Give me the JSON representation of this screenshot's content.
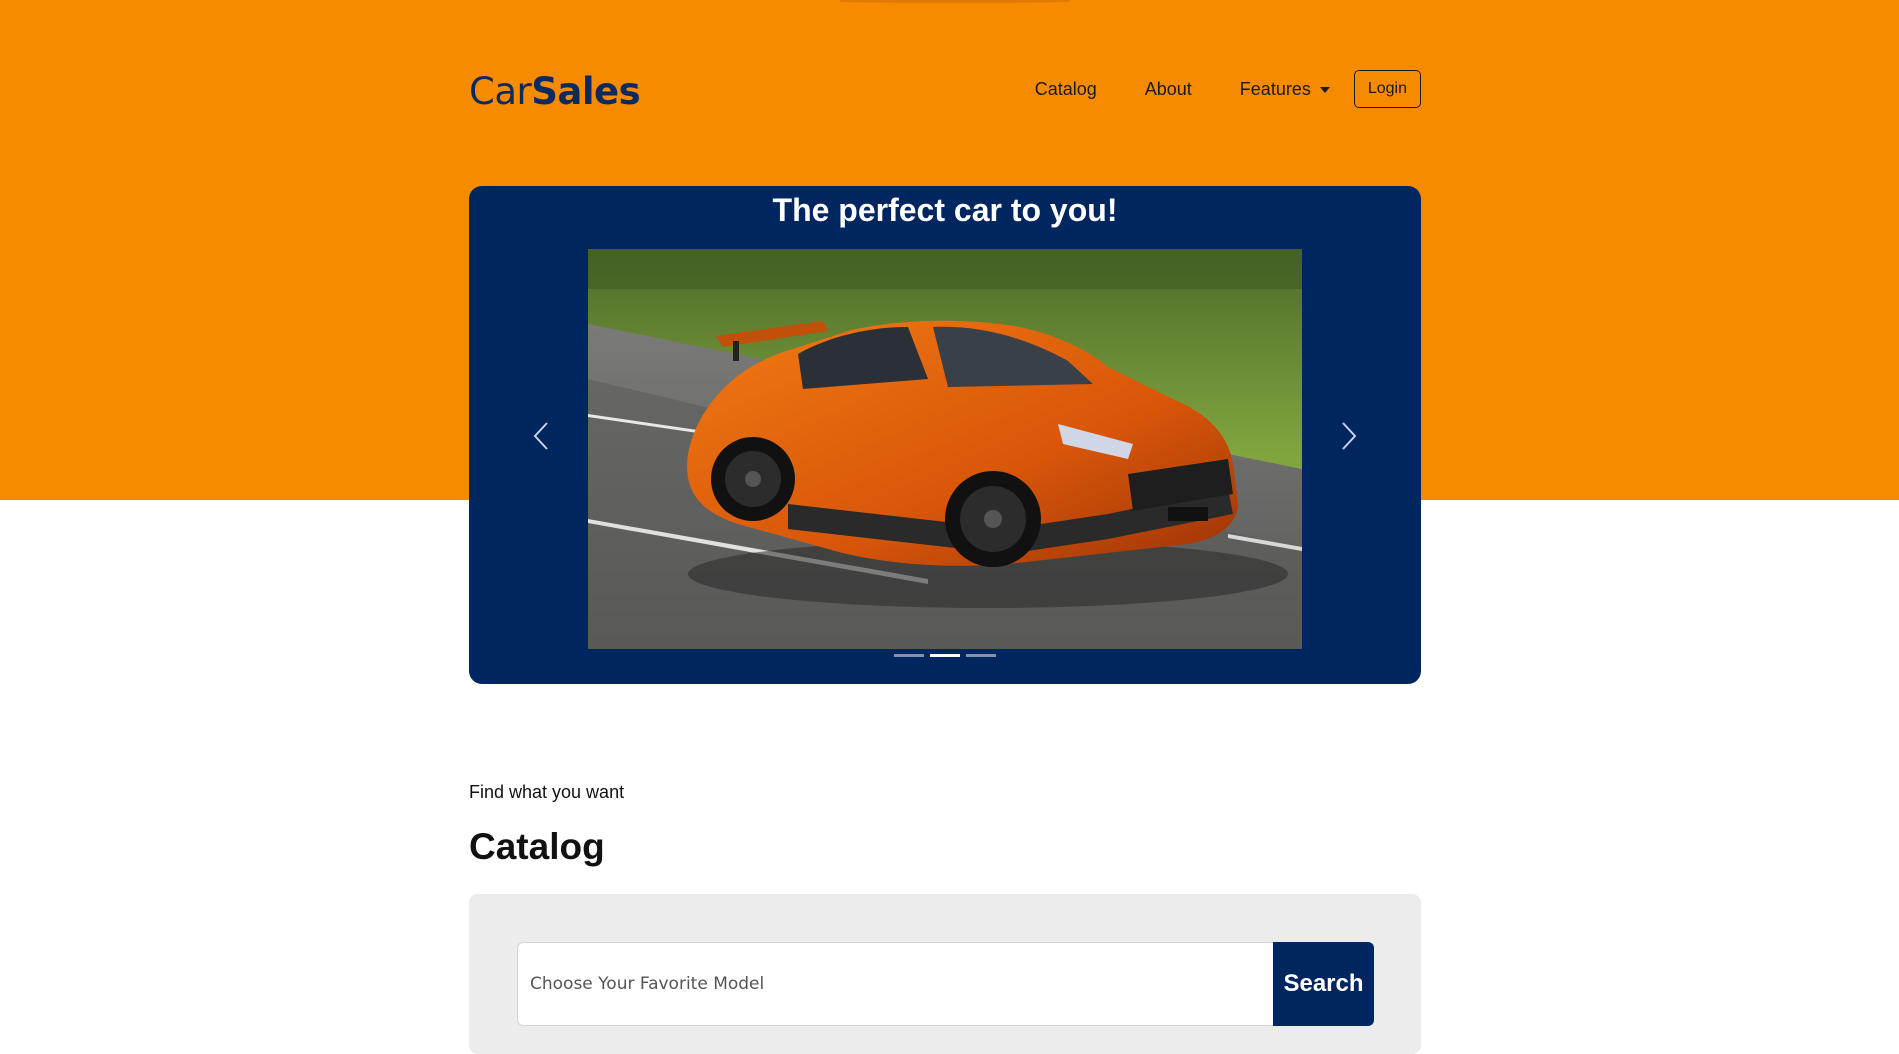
{
  "brand": {
    "light": "Car",
    "bold": "Sales"
  },
  "nav": {
    "links": [
      "Catalog",
      "About"
    ],
    "dropdown_label": "Features",
    "login_label": "Login"
  },
  "hero": {
    "title": "The perfect car to you!",
    "slide_count": 3,
    "active_slide": 2,
    "image_icon": "orange-sports-car-photo"
  },
  "catalog": {
    "eyebrow": "Find what you want",
    "title": "Catalog",
    "search_placeholder": "Choose Your Favorite Model",
    "search_value": "",
    "search_button": "Search"
  },
  "colors": {
    "accent": "#f68b00",
    "navy": "#002660",
    "panel": "#ececec"
  }
}
